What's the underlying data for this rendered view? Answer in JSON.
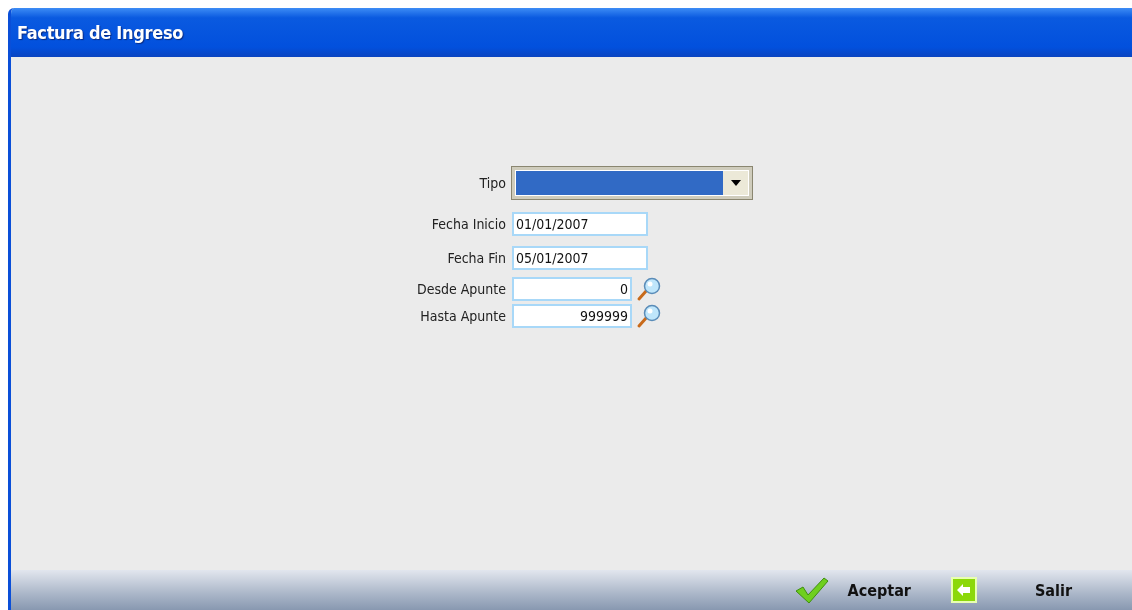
{
  "window": {
    "title": "Factura de Ingreso"
  },
  "fields": [
    {
      "kind": "combo",
      "label": "Tipo",
      "selected": true
    },
    {
      "kind": "text",
      "label": "Fecha Inicio",
      "value": "01/01/2007"
    },
    {
      "kind": "text",
      "label": "Fecha Fin",
      "value": "05/01/2007"
    },
    {
      "kind": "lookup",
      "label": "Desde Apunte",
      "value": "0"
    },
    {
      "kind": "lookup",
      "label": "Hasta Apunte",
      "value": "999999"
    }
  ],
  "buttons": [
    {
      "kind": "accept",
      "label": "Aceptar"
    },
    {
      "kind": "exit",
      "label": "Salir"
    }
  ]
}
